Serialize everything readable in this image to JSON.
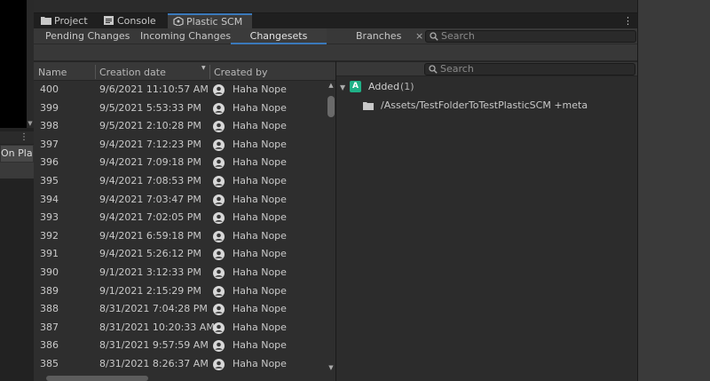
{
  "left_panel": {
    "on_play_label": "On Play"
  },
  "window_tabs": [
    {
      "label": "Project",
      "icon": "folder-icon"
    },
    {
      "label": "Console",
      "icon": "console-icon"
    },
    {
      "label": "Plastic SCM",
      "icon": "plastic-scm-icon"
    }
  ],
  "toolbar": {
    "tabs": [
      "Pending Changes",
      "Incoming Changes",
      "Changesets",
      "Branches"
    ],
    "active_tab": "Changesets",
    "close_glyph": "×",
    "search_placeholder": "Search"
  },
  "table": {
    "headers": {
      "name": "Name",
      "creation_date": "Creation date",
      "created_by": "Created by"
    },
    "sort_column": "creation_date",
    "sort_direction": "descending",
    "rows": [
      {
        "name": "400",
        "date": "9/6/2021 11:10:57 AM",
        "user": "Haha Nope"
      },
      {
        "name": "399",
        "date": "9/5/2021 5:53:33 PM",
        "user": "Haha Nope"
      },
      {
        "name": "398",
        "date": "9/5/2021 2:10:28 PM",
        "user": "Haha Nope"
      },
      {
        "name": "397",
        "date": "9/4/2021 7:12:23 PM",
        "user": "Haha Nope"
      },
      {
        "name": "396",
        "date": "9/4/2021 7:09:18 PM",
        "user": "Haha Nope"
      },
      {
        "name": "395",
        "date": "9/4/2021 7:08:53 PM",
        "user": "Haha Nope"
      },
      {
        "name": "394",
        "date": "9/4/2021 7:03:47 PM",
        "user": "Haha Nope"
      },
      {
        "name": "393",
        "date": "9/4/2021 7:02:05 PM",
        "user": "Haha Nope"
      },
      {
        "name": "392",
        "date": "9/4/2021 6:59:18 PM",
        "user": "Haha Nope"
      },
      {
        "name": "391",
        "date": "9/4/2021 5:26:12 PM",
        "user": "Haha Nope"
      },
      {
        "name": "390",
        "date": "9/1/2021 3:12:33 PM",
        "user": "Haha Nope"
      },
      {
        "name": "389",
        "date": "9/1/2021 2:15:29 PM",
        "user": "Haha Nope"
      },
      {
        "name": "388",
        "date": "8/31/2021 7:04:28 PM",
        "user": "Haha Nope"
      },
      {
        "name": "387",
        "date": "8/31/2021 10:20:33 AM",
        "user": "Haha Nope"
      },
      {
        "name": "386",
        "date": "8/31/2021 9:57:59 AM",
        "user": "Haha Nope"
      },
      {
        "name": "385",
        "date": "8/31/2021 8:26:37 AM",
        "user": "Haha Nope"
      }
    ]
  },
  "details": {
    "search_placeholder": "Search",
    "group_badge": "A",
    "group_label": "Added",
    "group_count": "(1)",
    "file_path": "/Assets/TestFolderToTestPlasticSCM +meta"
  },
  "colors": {
    "accent": "#3a79bb",
    "added_badge": "#1fb187"
  }
}
